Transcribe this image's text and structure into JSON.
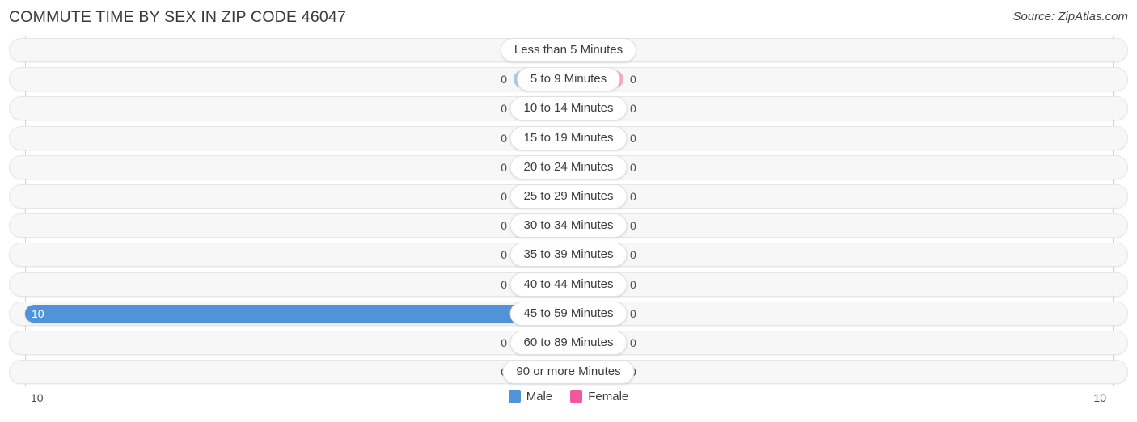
{
  "header": {
    "title": "COMMUTE TIME BY SEX IN ZIP CODE 46047",
    "source": "Source: ZipAtlas.com"
  },
  "legend": {
    "male_label": "Male",
    "female_label": "Female",
    "male_color": "#5193d8",
    "female_color": "#f2589d"
  },
  "axis": {
    "left_tick": "10",
    "right_tick": "10"
  },
  "chart_data": {
    "type": "bar",
    "orientation": "horizontal-diverging",
    "title": "COMMUTE TIME BY SEX IN ZIP CODE 46047",
    "xlabel": "",
    "ylabel": "",
    "xlim": [
      10,
      10
    ],
    "grid": false,
    "legend_position": "bottom-center",
    "categories": [
      "Less than 5 Minutes",
      "5 to 9 Minutes",
      "10 to 14 Minutes",
      "15 to 19 Minutes",
      "20 to 24 Minutes",
      "25 to 29 Minutes",
      "30 to 34 Minutes",
      "35 to 39 Minutes",
      "40 to 44 Minutes",
      "45 to 59 Minutes",
      "60 to 89 Minutes",
      "90 or more Minutes"
    ],
    "series": [
      {
        "name": "Male",
        "color": "#5193d8",
        "values": [
          0,
          0,
          0,
          0,
          0,
          0,
          0,
          0,
          0,
          10,
          0,
          0
        ]
      },
      {
        "name": "Female",
        "color": "#f2589d",
        "values": [
          0,
          0,
          0,
          0,
          0,
          0,
          0,
          0,
          0,
          0,
          0,
          0
        ]
      }
    ]
  },
  "rows": [
    {
      "label": "Less than 5 Minutes",
      "male": "0",
      "female": "0",
      "male_pct": 0,
      "female_pct": 0,
      "male_solid": false
    },
    {
      "label": "5 to 9 Minutes",
      "male": "0",
      "female": "0",
      "male_pct": 0,
      "female_pct": 0,
      "male_solid": false
    },
    {
      "label": "10 to 14 Minutes",
      "male": "0",
      "female": "0",
      "male_pct": 0,
      "female_pct": 0,
      "male_solid": false
    },
    {
      "label": "15 to 19 Minutes",
      "male": "0",
      "female": "0",
      "male_pct": 0,
      "female_pct": 0,
      "male_solid": false
    },
    {
      "label": "20 to 24 Minutes",
      "male": "0",
      "female": "0",
      "male_pct": 0,
      "female_pct": 0,
      "male_solid": false
    },
    {
      "label": "25 to 29 Minutes",
      "male": "0",
      "female": "0",
      "male_pct": 0,
      "female_pct": 0,
      "male_solid": false
    },
    {
      "label": "30 to 34 Minutes",
      "male": "0",
      "female": "0",
      "male_pct": 0,
      "female_pct": 0,
      "male_solid": false
    },
    {
      "label": "35 to 39 Minutes",
      "male": "0",
      "female": "0",
      "male_pct": 0,
      "female_pct": 0,
      "male_solid": false
    },
    {
      "label": "40 to 44 Minutes",
      "male": "0",
      "female": "0",
      "male_pct": 0,
      "female_pct": 0,
      "male_solid": false
    },
    {
      "label": "45 to 59 Minutes",
      "male": "10",
      "female": "0",
      "male_pct": 100,
      "female_pct": 0,
      "male_solid": true
    },
    {
      "label": "60 to 89 Minutes",
      "male": "0",
      "female": "0",
      "male_pct": 0,
      "female_pct": 0,
      "male_solid": false
    },
    {
      "label": "90 or more Minutes",
      "male": "0",
      "female": "0",
      "male_pct": 0,
      "female_pct": 0,
      "male_solid": false
    }
  ]
}
